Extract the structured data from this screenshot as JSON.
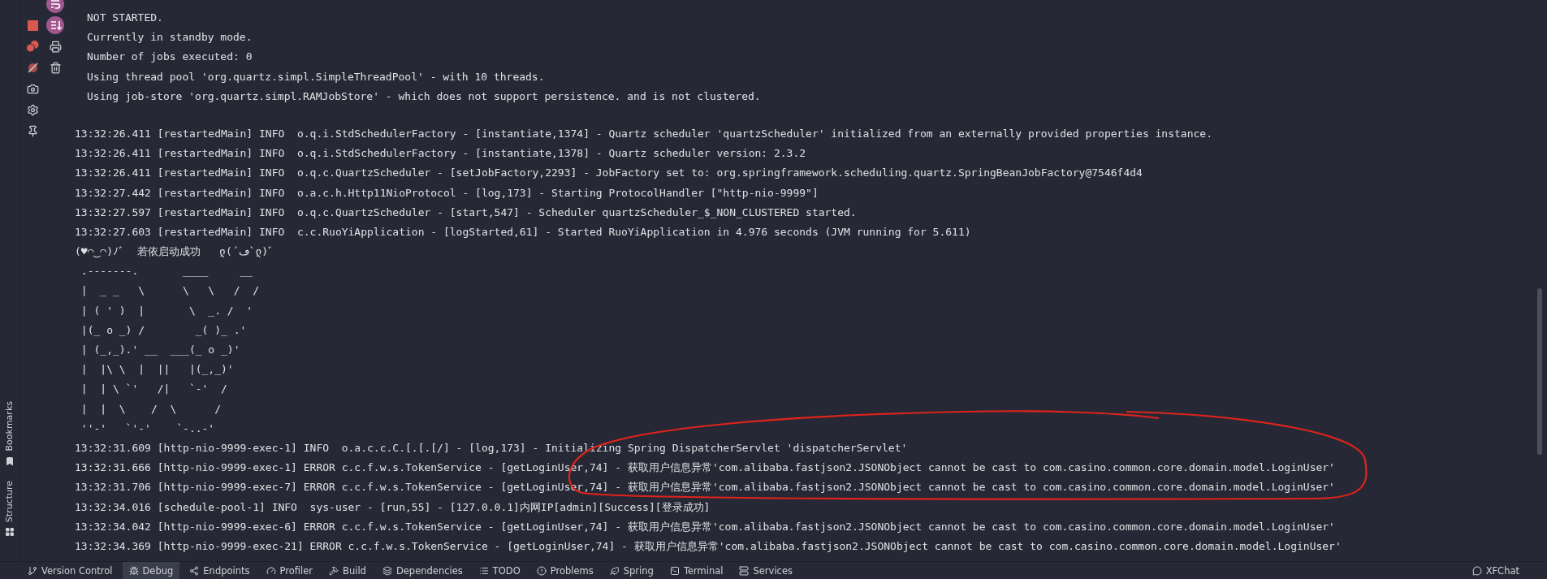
{
  "header_lines": [
    "NOT STARTED.",
    "Currently in standby mode.",
    "Number of jobs executed: 0",
    "Using thread pool 'org.quartz.simpl.SimpleThreadPool' - with 10 threads.",
    "Using job-store 'org.quartz.simpl.RAMJobStore' - which does not support persistence. and is not clustered."
  ],
  "log_lines": [
    "13:32:26.411 [restartedMain] INFO  o.q.i.StdSchedulerFactory - [instantiate,1374] - Quartz scheduler 'quartzScheduler' initialized from an externally provided properties instance.",
    "13:32:26.411 [restartedMain] INFO  o.q.i.StdSchedulerFactory - [instantiate,1378] - Quartz scheduler version: 2.3.2",
    "13:32:26.411 [restartedMain] INFO  o.q.c.QuartzScheduler - [setJobFactory,2293] - JobFactory set to: org.springframework.scheduling.quartz.SpringBeanJobFactory@7546f4d4",
    "13:32:27.442 [restartedMain] INFO  o.a.c.h.Http11NioProtocol - [log,173] - Starting ProtocolHandler [\"http-nio-9999\"]",
    "13:32:27.597 [restartedMain] INFO  o.q.c.QuartzScheduler - [start,547] - Scheduler quartzScheduler_$_NON_CLUSTERED started.",
    "13:32:27.603 [restartedMain] INFO  c.c.RuoYiApplication - [logStarted,61] - Started RuoYiApplication in 4.976 seconds (JVM running for 5.611)"
  ],
  "banner": {
    "greeting": "(♥◠‿◠)ﾉﾞ  若依启动成功   ლ(´ڡ`ლ)ﾞ",
    "art": [
      " .-------.       ____     __",
      " |  _ _   \\      \\   \\   /  /",
      " | ( ' )  |       \\  _. /  '",
      " |(_ o _) /        _( )_ .'",
      " | (_,_).' __  ___(_ o _)'",
      " |  |\\ \\  |  ||   |(_,_)'",
      " |  | \\ `'   /|   `-'  /",
      " |  |  \\    /  \\      /",
      " ''-'   `'-'    `-..-'"
    ]
  },
  "log_lines_2": [
    "13:32:31.609 [http-nio-9999-exec-1] INFO  o.a.c.c.C.[.[.[/] - [log,173] - Initializing Spring DispatcherServlet 'dispatcherServlet'",
    "13:32:31.666 [http-nio-9999-exec-1] ERROR c.c.f.w.s.TokenService - [getLoginUser,74] - 获取用户信息异常'com.alibaba.fastjson2.JSONObject cannot be cast to com.casino.common.core.domain.model.LoginUser'",
    "13:32:31.706 [http-nio-9999-exec-7] ERROR c.c.f.w.s.TokenService - [getLoginUser,74] - 获取用户信息异常'com.alibaba.fastjson2.JSONObject cannot be cast to com.casino.common.core.domain.model.LoginUser'",
    "13:32:34.016 [schedule-pool-1] INFO  sys-user - [run,55] - [127.0.0.1]内网IP[admin][Success][登录成功]",
    "13:32:34.042 [http-nio-9999-exec-6] ERROR c.c.f.w.s.TokenService - [getLoginUser,74] - 获取用户信息异常'com.alibaba.fastjson2.JSONObject cannot be cast to com.casino.common.core.domain.model.LoginUser'",
    "13:32:34.369 [http-nio-9999-exec-21] ERROR c.c.f.w.s.TokenService - [getLoginUser,74] - 获取用户信息异常'com.alibaba.fastjson2.JSONObject cannot be cast to com.casino.common.core.domain.model.LoginUser'"
  ],
  "side_labels": [
    "Bookmarks",
    "Structure"
  ],
  "bottom_tabs": [
    {
      "label": "Version Control",
      "selected": false
    },
    {
      "label": "Debug",
      "selected": true
    },
    {
      "label": "Endpoints",
      "selected": false
    },
    {
      "label": "Profiler",
      "selected": false
    },
    {
      "label": "Build",
      "selected": false
    },
    {
      "label": "Dependencies",
      "selected": false
    },
    {
      "label": "TODO",
      "selected": false
    },
    {
      "label": "Problems",
      "selected": false
    },
    {
      "label": "Spring",
      "selected": false
    },
    {
      "label": "Terminal",
      "selected": false
    },
    {
      "label": "Services",
      "selected": false
    }
  ],
  "right_tab": {
    "label": "XFChat",
    "selected": false
  }
}
